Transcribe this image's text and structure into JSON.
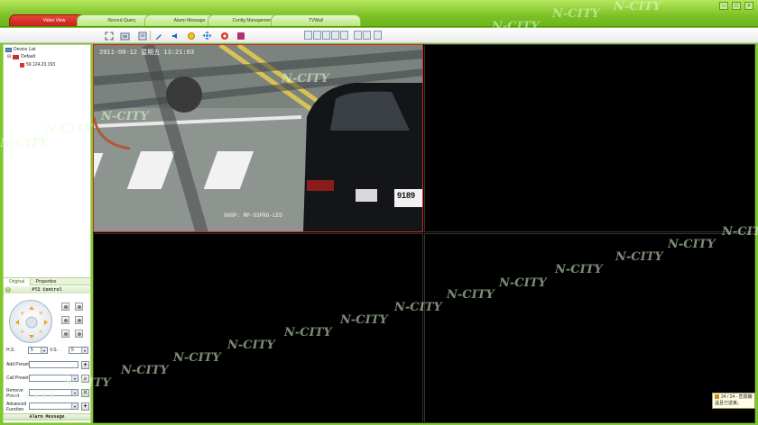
{
  "tabs": [
    {
      "label": "Video View",
      "active": true
    },
    {
      "label": "Record Query",
      "active": false
    },
    {
      "label": "Alarm Message",
      "active": false
    },
    {
      "label": "Config Management",
      "active": false
    },
    {
      "label": "TVWall",
      "active": false
    }
  ],
  "toolbar": {
    "buttons": [
      "fullscreen-icon",
      "snapshot-icon",
      "view-icon",
      "pen-icon",
      "audio-icon",
      "bell-icon",
      "move-icon",
      "record-icon",
      "stop-icon"
    ],
    "layout_buttons": [
      "layout-1-icon",
      "layout-4-icon",
      "layout-6-icon",
      "layout-8-icon",
      "layout-9-icon",
      "layout-16-icon",
      "layout-25-icon",
      "layout-36-icon"
    ]
  },
  "device_tree": {
    "root": "Device List",
    "group": "Default",
    "device": "59.124.23.193"
  },
  "panel_tabs": {
    "original": "Original",
    "properties": "Properties"
  },
  "ptz": {
    "title": "PTZ Control",
    "hs_label": "H.S.",
    "hs_value": "5",
    "vs_label": "V.S.",
    "vs_value": "5",
    "add_preset": "Add Preset",
    "call_preset": "Call Preset",
    "remove_preset": "Remove Preset",
    "advanced_function": "Advanced Function"
  },
  "alarm_message": "Alarm Message",
  "video": {
    "osd_time": "2011-08-12 星期五 13:21:03",
    "osd_camera": "960P: MP-93PRO-LED",
    "plate": "9189"
  },
  "watermark": "N-CITY",
  "notification": {
    "line1": "24 / 24 - 危險繼",
    "line2": "溫且已逆東。"
  },
  "colors": {
    "chrome_green": "#7ec82a",
    "active_tab_red": "#d2281e",
    "selected_pane_border": "#d2281e"
  }
}
